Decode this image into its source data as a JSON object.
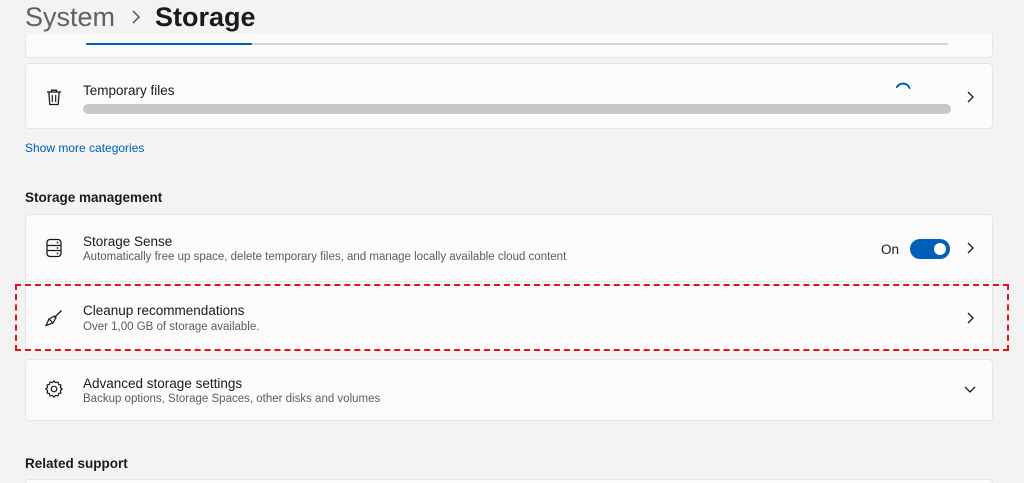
{
  "breadcrumb": {
    "parent": "System",
    "separator_icon": "chevron-right-icon",
    "current": "Storage"
  },
  "categories": {
    "temporary_files": {
      "icon": "trash-icon",
      "title": "Temporary files",
      "status": "loading"
    },
    "show_more_link": "Show more categories"
  },
  "storage_management": {
    "heading": "Storage management",
    "items": [
      {
        "icon": "storage-drive-icon",
        "title": "Storage Sense",
        "subtitle": "Automatically free up space, delete temporary files, and manage locally available cloud content",
        "toggle_label": "On",
        "toggle_on": true,
        "trailing_icon": "chevron-right-icon"
      },
      {
        "icon": "broom-icon",
        "title": "Cleanup recommendations",
        "subtitle": "Over 1,00 GB of storage available.",
        "trailing_icon": "chevron-right-icon",
        "highlighted": true
      },
      {
        "icon": "gear-icon",
        "title": "Advanced storage settings",
        "subtitle": "Backup options, Storage Spaces, other disks and volumes",
        "trailing_icon": "chevron-down-icon"
      }
    ]
  },
  "related_support": {
    "heading": "Related support"
  },
  "colors": {
    "accent": "#005fb8",
    "highlight_border": "#e0141b",
    "background": "#f3f3f3",
    "card": "#fbfbfb"
  }
}
